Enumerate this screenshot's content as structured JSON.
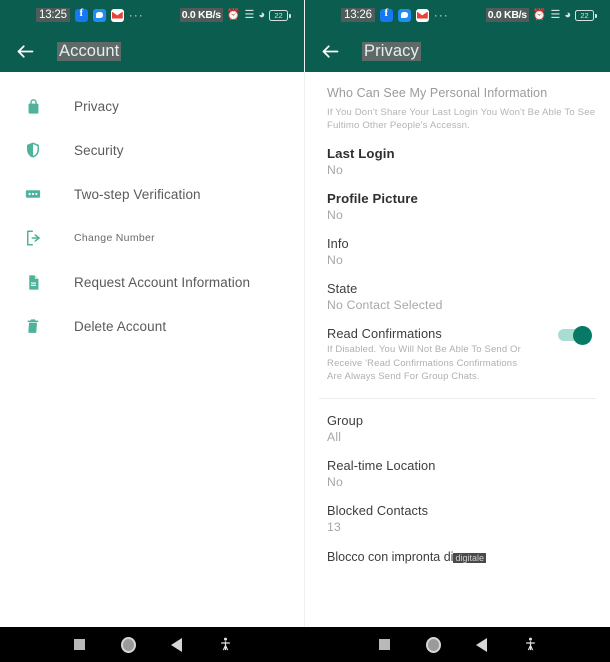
{
  "status_bar": {
    "left_time": "13:25",
    "right_time": "13:26",
    "net_speed": "0.0 KB/s",
    "battery": "22",
    "app_icons": [
      "facebook-icon",
      "messenger-icon",
      "gmail-icon"
    ],
    "overflow": "···"
  },
  "left_pane": {
    "appbar": {
      "title": "Account",
      "back_label": "back-arrow"
    },
    "items": [
      {
        "icon": "lock-icon",
        "label": "Privacy"
      },
      {
        "icon": "shield-icon",
        "label": "Security"
      },
      {
        "icon": "two-step-icon",
        "label": "Two-step Verification"
      },
      {
        "icon": "change-number-icon",
        "label": "Change Number"
      },
      {
        "icon": "document-icon",
        "label": "Request Account Information"
      },
      {
        "icon": "trash-icon",
        "label": "Delete Account"
      }
    ]
  },
  "right_pane": {
    "appbar": {
      "title": "Privacy",
      "back_label": "back-arrow"
    },
    "section_header": "Who Can See My Personal Information",
    "section_subtext": "If You Don't Share Your Last Login You Won't Be Able To See Fultimo Other People's Accessn.",
    "items": [
      {
        "title": "Last Login",
        "value": "No"
      },
      {
        "title": "Profile Picture",
        "value": "No"
      },
      {
        "title": "Info",
        "value": "No"
      },
      {
        "title": "State",
        "value": "No Contact Selected"
      }
    ],
    "read_confirmations": {
      "title": "Read Confirmations",
      "description": "If Disabled. You Will Not Be Able To Send Or Receive 'Read Confirmations Confirmations Are Always Send For Group Chats.",
      "toggle_state": "on"
    },
    "items_lower": [
      {
        "title": "Group",
        "value": "All"
      },
      {
        "title": "Real-time Location",
        "value": "No"
      },
      {
        "title": "Blocked Contacts",
        "value": "13"
      }
    ],
    "cut_item": {
      "text": "Blocco con impronta di",
      "badge": "digitale"
    }
  },
  "nav_bar": {
    "buttons": [
      "recents-button",
      "home-button",
      "back-button",
      "accessibility-button"
    ]
  },
  "colors": {
    "appbar_green": "#0b5e4f",
    "icon_teal": "#4fb39b",
    "toggle_on": "#067a64"
  }
}
